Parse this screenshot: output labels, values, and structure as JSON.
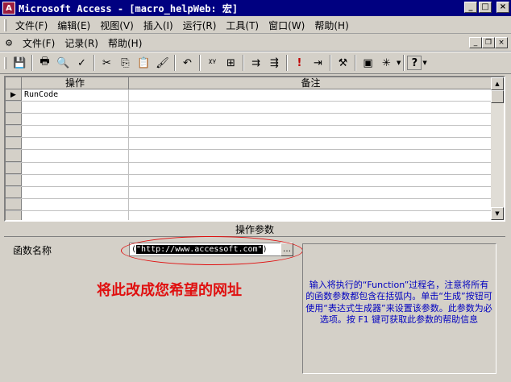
{
  "window": {
    "app_icon_letter": "A",
    "title": "Microsoft Access - [macro_helpWeb: 宏]",
    "min_glyph": "_",
    "max_glyph": "□",
    "close_glyph": "×"
  },
  "menubar": {
    "items": [
      "文件(F)",
      "编辑(E)",
      "视图(V)",
      "插入(I)",
      "运行(R)",
      "工具(T)",
      "窗口(W)",
      "帮助(H)"
    ]
  },
  "child_menubar": {
    "items": [
      "文件(F)",
      "记录(R)",
      "帮助(H)"
    ],
    "buttons": [
      "_",
      "❐",
      "×"
    ]
  },
  "toolbar": {
    "buttons": [
      {
        "name": "save-icon",
        "glyph": "💾"
      },
      {
        "name": "print-icon",
        "glyph": "🖶"
      },
      {
        "name": "print-preview-icon",
        "glyph": "🔍"
      },
      {
        "name": "spelling-icon",
        "glyph": "✓"
      },
      {
        "name": "sep"
      },
      {
        "name": "cut-icon",
        "glyph": "✂"
      },
      {
        "name": "copy-icon",
        "glyph": "⎘"
      },
      {
        "name": "paste-icon",
        "glyph": "📋"
      },
      {
        "name": "format-painter-icon",
        "glyph": "🖌"
      },
      {
        "name": "sep"
      },
      {
        "name": "undo-icon",
        "glyph": "↶"
      },
      {
        "name": "sep"
      },
      {
        "name": "macro-names-icon",
        "glyph": "ᵡᵞ"
      },
      {
        "name": "conditions-icon",
        "glyph": "⊞"
      },
      {
        "name": "sep"
      },
      {
        "name": "insert-rows-icon",
        "glyph": "⇉"
      },
      {
        "name": "delete-rows-icon",
        "glyph": "⇶"
      },
      {
        "name": "sep"
      },
      {
        "name": "run-icon",
        "glyph": "!"
      },
      {
        "name": "single-step-icon",
        "glyph": "⇥"
      },
      {
        "name": "sep"
      },
      {
        "name": "build-icon",
        "glyph": "⚒"
      },
      {
        "name": "sep"
      },
      {
        "name": "database-window-icon",
        "glyph": "▣"
      },
      {
        "name": "new-object-icon",
        "glyph": "✳"
      },
      {
        "name": "sep"
      },
      {
        "name": "help-icon",
        "glyph": "?"
      }
    ]
  },
  "grid": {
    "headers": {
      "action": "操作",
      "comment": "备注"
    },
    "current_row_marker": "▶",
    "rows": [
      {
        "action": "RunCode",
        "comment": ""
      },
      {
        "action": "",
        "comment": ""
      },
      {
        "action": "",
        "comment": ""
      },
      {
        "action": "",
        "comment": ""
      },
      {
        "action": "",
        "comment": ""
      },
      {
        "action": "",
        "comment": ""
      },
      {
        "action": "",
        "comment": ""
      },
      {
        "action": "",
        "comment": ""
      },
      {
        "action": "",
        "comment": ""
      },
      {
        "action": "",
        "comment": ""
      },
      {
        "action": "",
        "comment": ""
      }
    ],
    "scroll_up": "▲",
    "scroll_down": "▼"
  },
  "params": {
    "header": "操作参数",
    "function_label": "函数名称",
    "function_value_open": "(",
    "function_value_selected": "\"http://www.accessoft.com\"",
    "function_value_close": ")",
    "builder_glyph": "…",
    "annotation": "将此改成您希望的网址",
    "help": "输入将执行的“Function”过程名，注意将所有的函数参数都包含在括弧内。单击“生成”按钮可使用“表达式生成器”来设置该参数。此参数为必选项。按 F1 键可获取此参数的帮助信息"
  },
  "colors": {
    "title_bar": "#000080",
    "face": "#d4d0c8",
    "annotation": "#e01010",
    "help_text": "#0000c0"
  }
}
